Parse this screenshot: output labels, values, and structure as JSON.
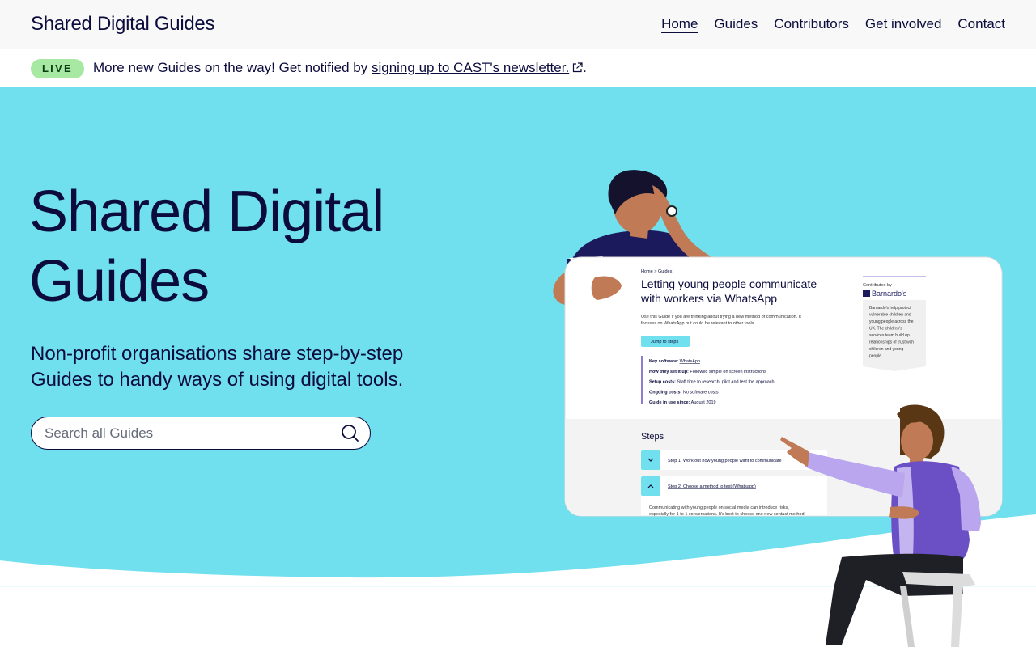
{
  "header": {
    "site_name": "Shared Digital Guides",
    "nav": [
      {
        "label": "Home",
        "active": true
      },
      {
        "label": "Guides"
      },
      {
        "label": "Contributors"
      },
      {
        "label": "Get involved"
      },
      {
        "label": "Contact"
      }
    ]
  },
  "phase_banner": {
    "tag": "LIVE",
    "text": "More new Guides on the way! Get notified by ",
    "link_text": "signing up to CAST's newsletter.",
    "suffix": "."
  },
  "hero": {
    "title": "Shared Digital Guides",
    "lede": "Non-profit organisations share step-by-step Guides to handy ways of using digital tools.",
    "search_placeholder": "Search all Guides"
  },
  "guide_preview": {
    "breadcrumb": "Home > Guides",
    "title_line1": "Letting young people communicate",
    "title_line2": "with workers via WhatsApp",
    "intro_line1": "Use this Guide if you are thinking about trying a new method of communication. It",
    "intro_line2": "focuses on WhatsApp but could be relevant to other tools.",
    "jump_button": "Jump to steps",
    "facts": [
      {
        "label": "Key software:",
        "value": "WhatsApp"
      },
      {
        "label": "How they set it up:",
        "value": "Followed simple on screen instructions"
      },
      {
        "label": "Setup costs:",
        "value": "Staff time to research, pilot and test the approach"
      },
      {
        "label": "Ongoing costs:",
        "value": "No software costs"
      },
      {
        "label": "Guide in use since:",
        "value": "August 2019"
      }
    ],
    "contributed_by": "Contributed by",
    "org_name": "Barnardo's",
    "org_blurb": [
      "Barnardo's help protect",
      "vulnerable children and",
      "young people across the",
      "UK. The children's",
      "services team build up",
      "relationships of trust with",
      "children and young",
      "people."
    ],
    "steps_heading": "Steps",
    "steps": [
      "Step 1: Work out how young people want to communicate",
      "Step 2: Choose a method to test (Whatsapp)"
    ],
    "step_body_line1": "Communicating with young people on social media can introduce risks,",
    "step_body_line2": "especially for 1 to 1 conversations. It's best to choose one new contact method"
  },
  "colors": {
    "hero_bg": "#70dfee",
    "text": "#0b0c3c",
    "live_tag": "#a7e8a2",
    "jump_button": "#70dfee",
    "vest": "#6a50c4",
    "sleeve": "#b9a6ee",
    "navy_shirt": "#1b1a5c"
  },
  "icons": [
    "external-link-icon",
    "search-icon",
    "chevron-down-icon",
    "chevron-up-icon"
  ]
}
